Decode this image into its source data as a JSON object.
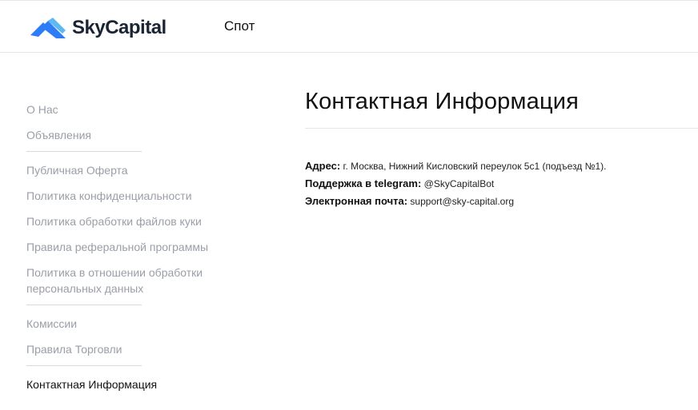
{
  "header": {
    "logo_text": "SkyCapital",
    "logo_colors": {
      "primary": "#2f7df6",
      "light": "#5fb8f0",
      "text": "#1b2434"
    },
    "nav_spot": "Спот"
  },
  "sidebar": {
    "groups": [
      [
        "О Нас",
        "Объявления"
      ],
      [
        "Публичная Оферта",
        "Политика конфиденциальности",
        "Политика обработки файлов куки",
        "Правила реферальной программы",
        "Политика в отношении обработки персональных данных"
      ],
      [
        "Комиссии",
        "Правила Торговли"
      ],
      [
        "Контактная Информация"
      ]
    ],
    "active": "Контактная Информация"
  },
  "main": {
    "title": "Контактная Информация",
    "rows": [
      {
        "label": "Адрес:",
        "value": "г. Москва, Нижний Кисловский переулок 5с1 (подъезд №1)."
      },
      {
        "label": "Поддержка в telegram:",
        "value": "@SkyCapitalBot"
      },
      {
        "label": "Электронная почта:",
        "value": "support@sky-capital.org"
      }
    ]
  }
}
